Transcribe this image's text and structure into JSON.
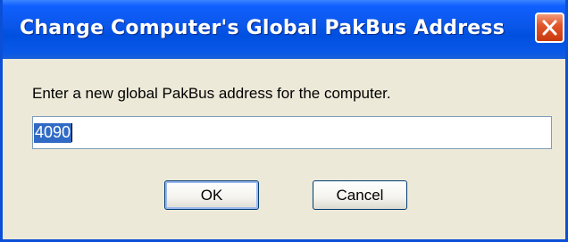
{
  "dialog": {
    "title": "Change Computer's Global PakBus Address",
    "close_icon": "close-icon",
    "prompt": "Enter a new global PakBus address for the computer.",
    "address_value": "4090",
    "ok_label": "OK",
    "cancel_label": "Cancel"
  },
  "colors": {
    "titlebar": "#0a56e8",
    "close_button": "#e1572a",
    "selection": "#316ac5",
    "window_background": "#ece9d8"
  }
}
